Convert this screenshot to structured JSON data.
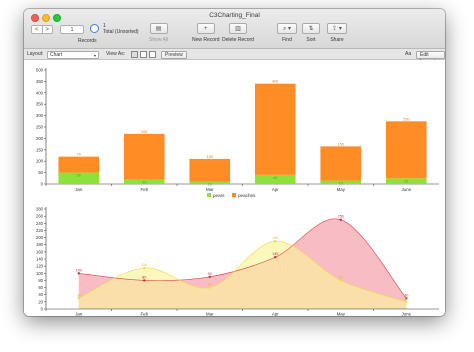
{
  "window": {
    "title": "C3Charting_Final"
  },
  "toolbar": {
    "back": "<",
    "forward": ">",
    "record_number": "1",
    "records_total": "1",
    "records_status": "Total (Unsorted)",
    "records_label": "Records",
    "show_all": "Show All",
    "new_record": "New Record",
    "delete_record": "Delete Record",
    "find": "Find",
    "sort": "Sort",
    "share": "Share"
  },
  "layout_bar": {
    "layout_label": "Layout:",
    "layout_value": "Chart",
    "view_as_label": "View As:",
    "preview": "Preview",
    "aa": "Aa",
    "edit_layout": "Edit Layout"
  },
  "colors": {
    "pears": "#8ee03a",
    "peaches": "#ff8c25",
    "area_pink": "#f7b6be",
    "area_yellow": "#fbf29a",
    "area_orange": "#ffd09a"
  },
  "chart_data": [
    {
      "type": "bar",
      "stacked": true,
      "categories": [
        "Jan",
        "Feb",
        "Mar",
        "Apr",
        "May",
        "June"
      ],
      "series": [
        {
          "name": "pears",
          "values": [
            50,
            20,
            10,
            40,
            15,
            25
          ],
          "labels": [
            "50",
            "20",
            "10",
            "40",
            "15",
            "25"
          ]
        },
        {
          "name": "peaches",
          "values": [
            70,
            200,
            100,
            400,
            150,
            250
          ],
          "labels": [
            "70",
            "200",
            "100",
            "400",
            "150",
            "250"
          ]
        }
      ],
      "ylim": [
        0,
        500
      ],
      "yticks": [
        "0",
        "50",
        "100",
        "150",
        "200",
        "250",
        "300",
        "350",
        "400",
        "450",
        "500"
      ],
      "legend": "bottom",
      "grid": false
    },
    {
      "type": "area",
      "categories": [
        "Jan",
        "Feb",
        "Mar",
        "Apr",
        "May",
        "June"
      ],
      "series": [
        {
          "values": [
            30,
            115,
            60,
            190,
            80,
            20
          ],
          "labels": [
            "30",
            "115",
            "60",
            "190",
            "80",
            "20"
          ]
        },
        {
          "values": [
            100,
            80,
            90,
            145,
            250,
            30
          ],
          "labels": [
            "100",
            "80",
            "90",
            "145",
            "250",
            "30"
          ]
        }
      ],
      "ylim": [
        0,
        280
      ],
      "yticks": [
        "0",
        "20",
        "40",
        "60",
        "80",
        "100",
        "120",
        "140",
        "160",
        "180",
        "200",
        "220",
        "240",
        "260",
        "280"
      ],
      "grid": false
    }
  ]
}
